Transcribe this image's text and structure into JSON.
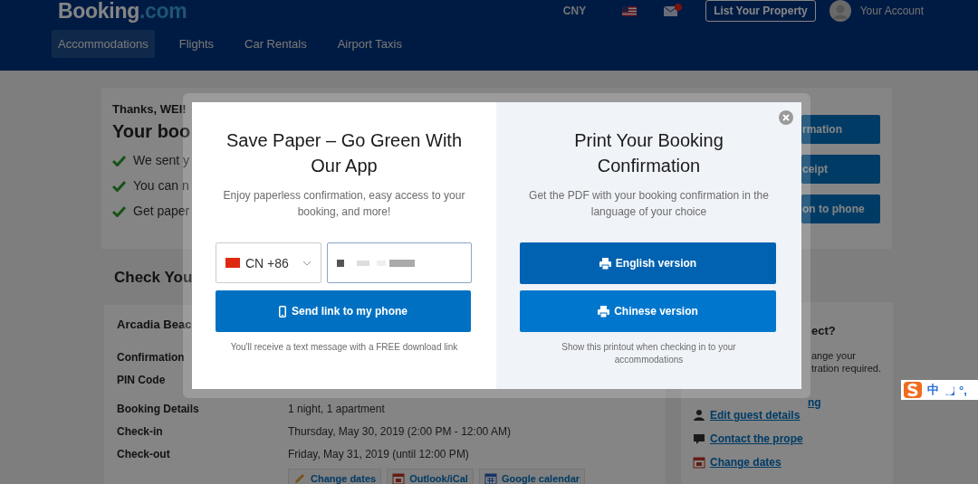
{
  "header": {
    "logo": {
      "name": "Booking",
      "suffix": ".com"
    },
    "currency": "CNY",
    "list_property": "List Your Property",
    "account": "Your Account",
    "nav": [
      {
        "label": "Accommodations",
        "selected": true
      },
      {
        "label": "Flights",
        "selected": false
      },
      {
        "label": "Car Rentals",
        "selected": false
      },
      {
        "label": "Airport Taxis",
        "selected": false
      }
    ]
  },
  "booking_card": {
    "greeting": "Thanks, WEI!",
    "title": "Your boo",
    "checklist": [
      "We sent y",
      "You can n",
      "Get paper"
    ],
    "buttons": [
      "rmation",
      "ceipt",
      "on to phone"
    ]
  },
  "check_heading": "Check You",
  "details": {
    "property": "Arcadia Beac",
    "rows": [
      {
        "label": "Confirmation"
      },
      {
        "label": "PIN Code"
      },
      {
        "label": "Booking Details",
        "value": "1 night, 1 apartment"
      },
      {
        "label": "Check-in",
        "value": "Thursday, May 30, 2019 (2:00 PM - 12:00 AM)"
      },
      {
        "label": "Check-out",
        "value": "Friday, May 31, 2019 (until 12:00 PM)"
      }
    ],
    "actions": [
      {
        "kind": "pencil",
        "label": "Change dates"
      },
      {
        "kind": "calendar",
        "label": "Outlook/iCal"
      },
      {
        "kind": "grid",
        "label": "Google calendar"
      }
    ]
  },
  "side_panel": {
    "title": "ect?",
    "text_lines": [
      "ange your",
      "tration required."
    ],
    "links": [
      {
        "label": "ng"
      },
      {
        "kind": "person",
        "label": "Edit guest details"
      },
      {
        "kind": "chat",
        "label": "Contact the prope"
      },
      {
        "kind": "calendar",
        "label": "Change dates"
      }
    ]
  },
  "modal": {
    "app": {
      "title": "Save Paper – Go Green With Our App",
      "text": "Enjoy paperless confirmation, easy access to your booking, and more!",
      "country_code": "CN +86",
      "button": "Send link to my phone",
      "note": "You'll receive a text message with a FREE download link"
    },
    "print": {
      "title": "Print Your Booking Confirmation",
      "text": "Get the PDF with your booking confirmation in the language of your choice",
      "buttons": [
        {
          "label": "English version",
          "hovered": true
        },
        {
          "label": "Chinese version",
          "hovered": false
        }
      ],
      "note": "Show this printout when checking in to your accommodations"
    }
  },
  "ime_toolbar": {
    "mode": "中",
    "punctuation": "°,"
  }
}
